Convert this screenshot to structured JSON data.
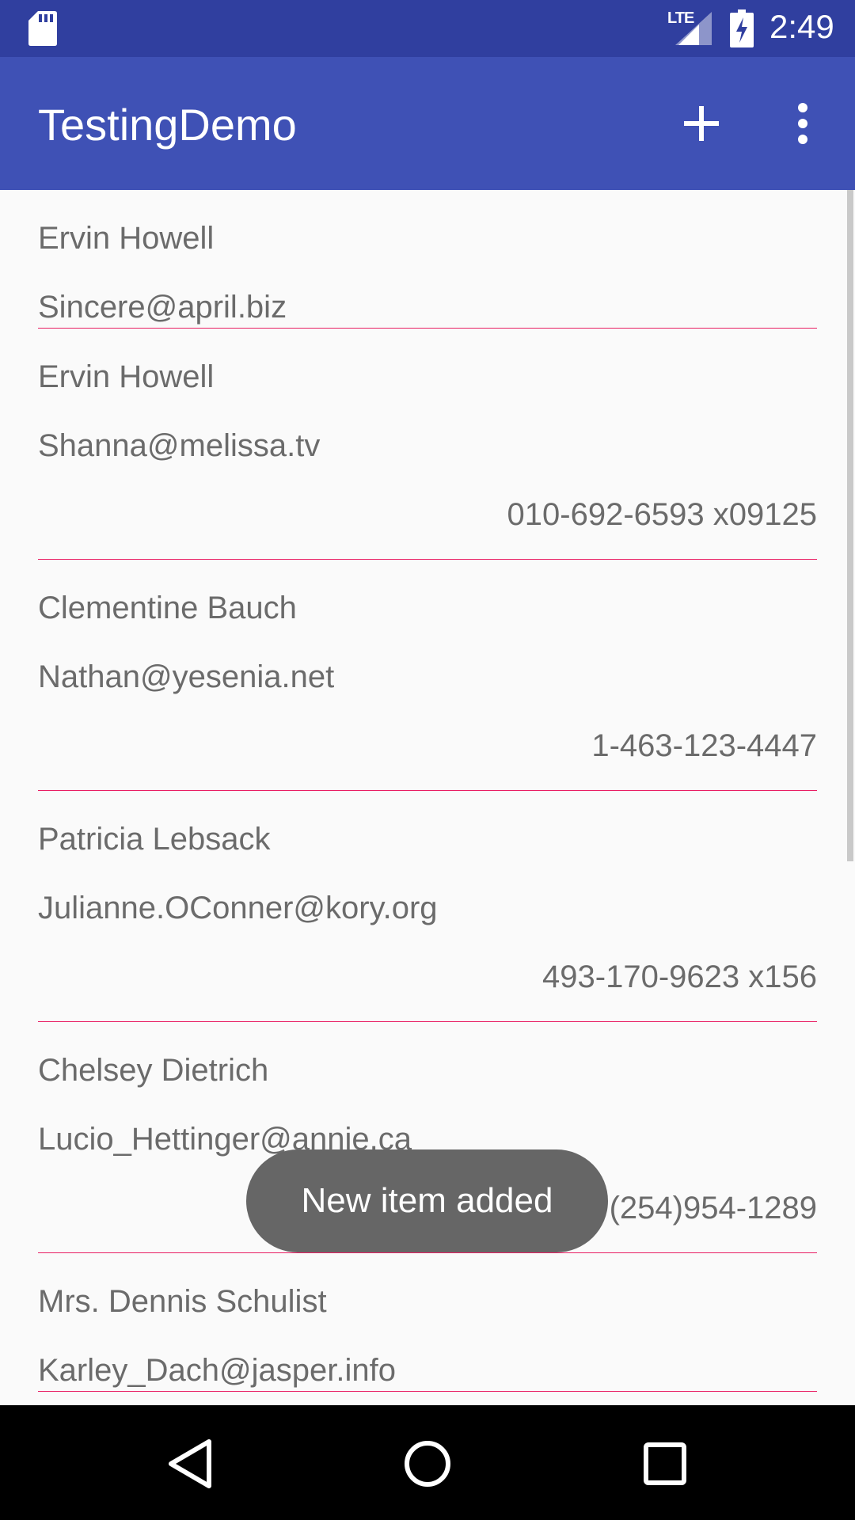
{
  "status_bar": {
    "network_label": "LTE",
    "time": "2:49",
    "icons": [
      "sd-card-icon",
      "signal-icon",
      "battery-charging-icon"
    ]
  },
  "app_bar": {
    "title": "TestingDemo",
    "actions": [
      "add-icon",
      "more-vert-icon"
    ]
  },
  "contacts": [
    {
      "name": "Ervin Howell",
      "email": "Sincere@april.biz",
      "phone": ""
    },
    {
      "name": "Ervin Howell",
      "email": "Shanna@melissa.tv",
      "phone": "010-692-6593 x09125"
    },
    {
      "name": "Clementine Bauch",
      "email": "Nathan@yesenia.net",
      "phone": "1-463-123-4447"
    },
    {
      "name": "Patricia Lebsack",
      "email": "Julianne.OConner@kory.org",
      "phone": "493-170-9623 x156"
    },
    {
      "name": "Chelsey Dietrich",
      "email": "Lucio_Hettinger@annie.ca",
      "phone": "(254)954-1289"
    },
    {
      "name": "Mrs. Dennis Schulist",
      "email": "Karley_Dach@jasper.info",
      "phone": ""
    }
  ],
  "toast": {
    "message": "New item added"
  },
  "navigation": {
    "buttons": [
      "back-icon",
      "home-icon",
      "recents-icon"
    ]
  },
  "colors": {
    "status_bar": "#303f9f",
    "app_bar": "#3f51b5",
    "divider": "#e91e63",
    "toast": "#666666"
  }
}
